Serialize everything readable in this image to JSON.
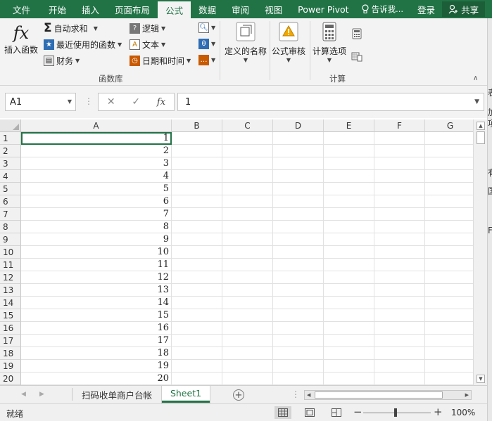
{
  "tabs": [
    {
      "label": "文件"
    },
    {
      "label": "开始"
    },
    {
      "label": "插入"
    },
    {
      "label": "页面布局"
    },
    {
      "label": "公式"
    },
    {
      "label": "数据"
    },
    {
      "label": "审阅"
    },
    {
      "label": "视图"
    },
    {
      "label": "Power Pivot"
    }
  ],
  "tell_me": "告诉我...",
  "login": "登录",
  "share": "共享",
  "ribbon": {
    "insert_function": "插入函数",
    "autosum": "自动求和",
    "recent": "最近使用的函数",
    "financial": "财务",
    "logical": "逻辑",
    "text": "文本",
    "datetime": "日期和时间",
    "group_function_library": "函数库",
    "defined_names": "定义的名称",
    "formula_auditing": "公式审核",
    "calc_options": "计算选项",
    "group_calculation": "计算"
  },
  "formula_bar": {
    "name_box": "A1",
    "value": "1",
    "fx": "fx"
  },
  "columns": [
    "A",
    "B",
    "C",
    "D",
    "E",
    "F",
    "G"
  ],
  "rows": [
    {
      "n": "1",
      "a": "1"
    },
    {
      "n": "2",
      "a": "2"
    },
    {
      "n": "3",
      "a": "3"
    },
    {
      "n": "4",
      "a": "4"
    },
    {
      "n": "5",
      "a": "5"
    },
    {
      "n": "6",
      "a": "6"
    },
    {
      "n": "7",
      "a": "7"
    },
    {
      "n": "8",
      "a": "8"
    },
    {
      "n": "9",
      "a": "9"
    },
    {
      "n": "10",
      "a": "10"
    },
    {
      "n": "11",
      "a": "11"
    },
    {
      "n": "12",
      "a": "12"
    },
    {
      "n": "13",
      "a": "13"
    },
    {
      "n": "14",
      "a": "14"
    },
    {
      "n": "15",
      "a": "15"
    },
    {
      "n": "16",
      "a": "16"
    },
    {
      "n": "17",
      "a": "17"
    },
    {
      "n": "18",
      "a": "18"
    },
    {
      "n": "19",
      "a": "19"
    },
    {
      "n": "20",
      "a": "20"
    }
  ],
  "sheets": [
    {
      "label": "扫码收单商户台帐",
      "active": false
    },
    {
      "label": "Sheet1",
      "active": true
    }
  ],
  "status": {
    "ready": "就绪",
    "zoom": "100%"
  },
  "edge_fragments": [
    "表",
    "加",
    "项",
    "有",
    "国",
    "Fi"
  ],
  "accent_color": "#217346"
}
